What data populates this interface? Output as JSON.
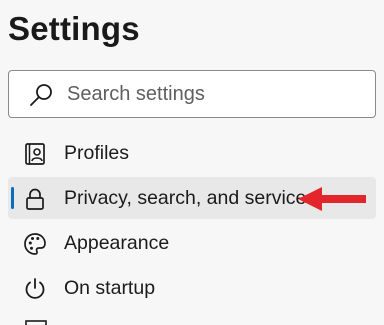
{
  "page": {
    "title": "Settings"
  },
  "search": {
    "placeholder": "Search settings",
    "icon": "search-icon"
  },
  "nav": {
    "items": [
      {
        "label": "Profiles",
        "icon": "profiles-icon",
        "selected": false
      },
      {
        "label": "Privacy, search, and services",
        "icon": "lock-icon",
        "selected": true
      },
      {
        "label": "Appearance",
        "icon": "palette-icon",
        "selected": false
      },
      {
        "label": "On startup",
        "icon": "power-icon",
        "selected": false
      }
    ]
  },
  "annotation": {
    "arrow_color": "#e3262c",
    "accent_color": "#0f6cbd"
  }
}
